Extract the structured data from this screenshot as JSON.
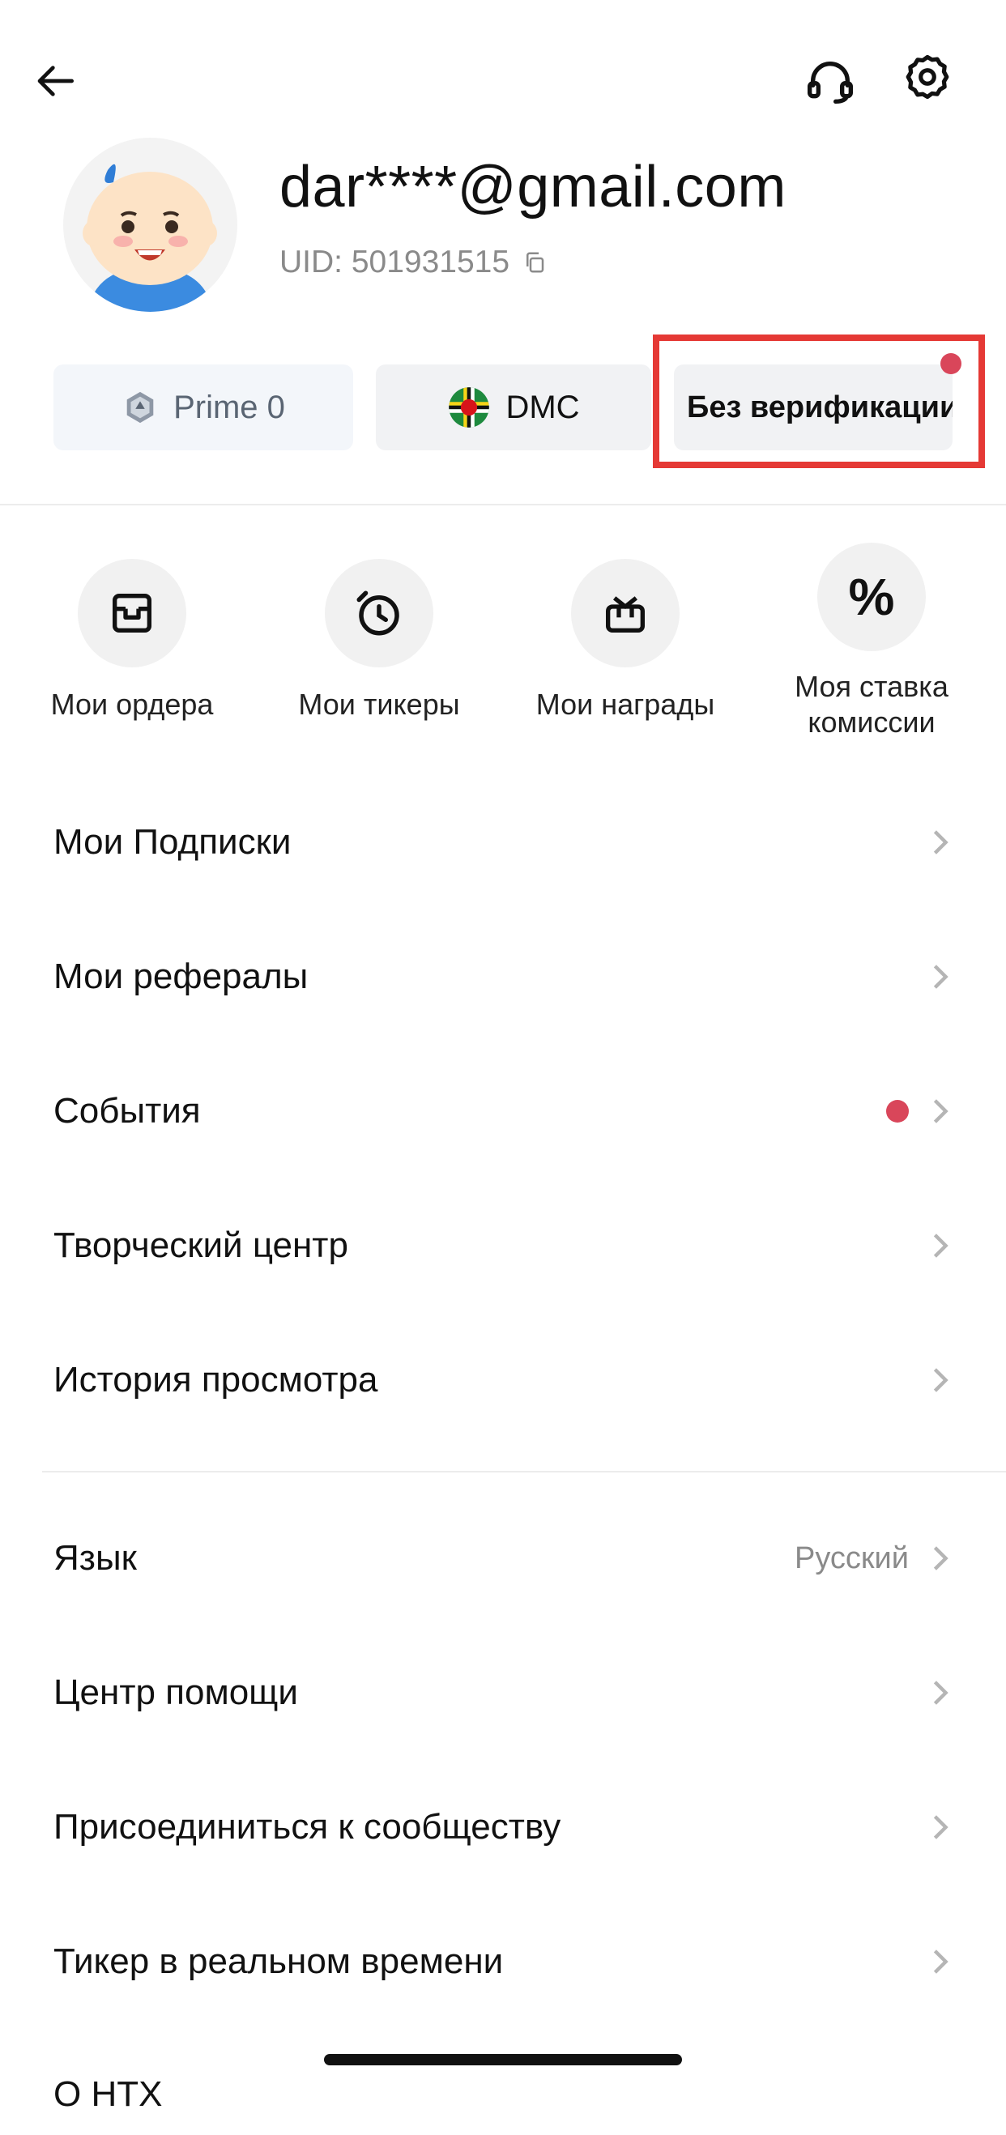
{
  "header": {
    "back_icon": "arrow-left-icon",
    "support_icon": "headset-icon",
    "settings_icon": "gear-icon"
  },
  "profile": {
    "email": "dar****@gmail.com",
    "uid": "UID: 501931515",
    "copy_icon": "copy-icon"
  },
  "badges": {
    "prime": "Prime 0",
    "region": "DMC",
    "verification": "Без верификации"
  },
  "quick_actions": [
    {
      "label": "Мои ордера",
      "icon": "orders-icon"
    },
    {
      "label": "Мои тикеры",
      "icon": "timer-icon"
    },
    {
      "label": "Мои награды",
      "icon": "gift-icon"
    },
    {
      "label": "Моя ставка комиссии",
      "icon": "percent-icon"
    }
  ],
  "menu_section1": [
    {
      "label": "Мои Подписки"
    },
    {
      "label": "Мои рефералы"
    },
    {
      "label": "События",
      "has_dot": true
    },
    {
      "label": "Творческий центр"
    },
    {
      "label": "История просмотра"
    }
  ],
  "menu_section2": [
    {
      "label": "Язык",
      "value": "Русский"
    },
    {
      "label": "Центр помощи"
    },
    {
      "label": "Присоединиться к сообществу"
    },
    {
      "label": "Тикер в реальном времени"
    },
    {
      "label": "О HTX"
    }
  ],
  "colors": {
    "accent_red": "#d9465a",
    "highlight_red": "#e53935",
    "muted_text": "#8a8a8a"
  }
}
